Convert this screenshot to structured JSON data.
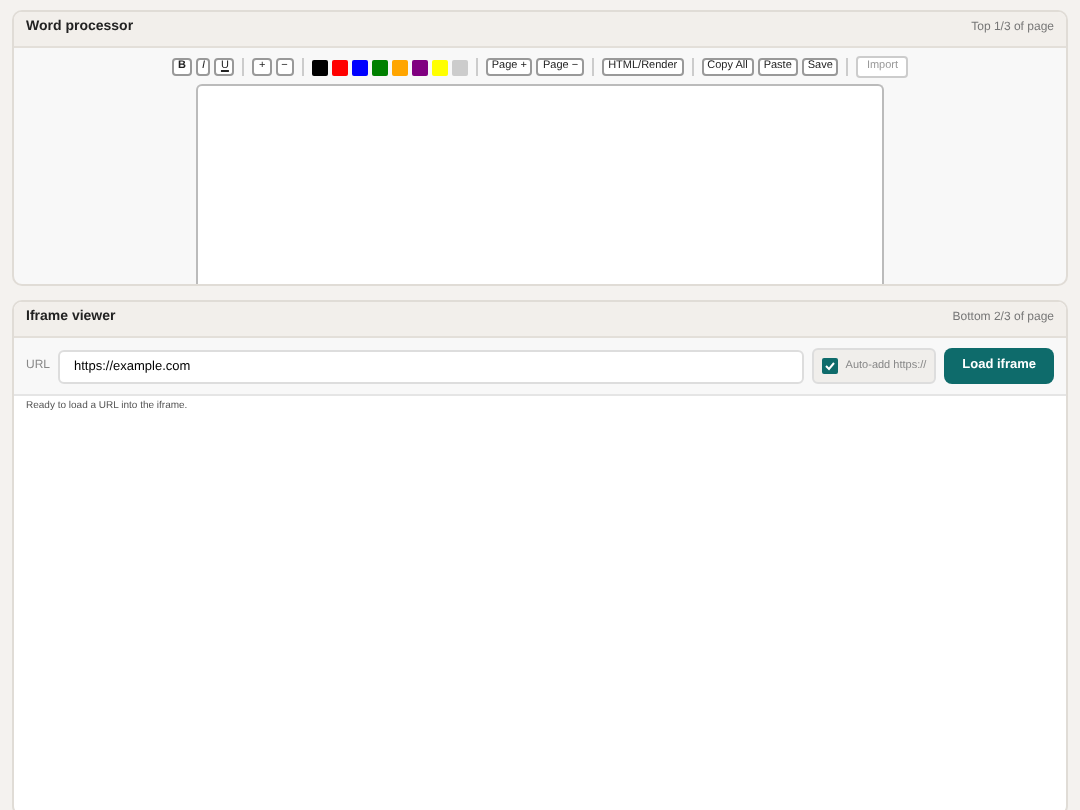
{
  "word_processor": {
    "title": "Word processor",
    "note": "Top 1/3 of page",
    "toolbar": [
      [
        {
          "kind": "bold",
          "label": "B",
          "disabled": false
        },
        {
          "kind": "italic",
          "label": "I",
          "disabled": false
        },
        {
          "kind": "underline",
          "label": "U",
          "disabled": false
        }
      ],
      [
        {
          "kind": "button",
          "label": "+",
          "disabled": false
        },
        {
          "kind": "button",
          "label": "−",
          "disabled": false
        }
      ],
      [
        {
          "kind": "swatch",
          "color": "#000000"
        },
        {
          "kind": "swatch",
          "color": "#ff0000"
        },
        {
          "kind": "swatch",
          "color": "#0000ff"
        },
        {
          "kind": "swatch",
          "color": "#008000"
        },
        {
          "kind": "swatch",
          "color": "#ffa500"
        },
        {
          "kind": "swatch",
          "color": "#800080"
        },
        {
          "kind": "swatch",
          "color": "#ffff00"
        },
        {
          "kind": "swatch",
          "color": "#cccccc"
        }
      ],
      [
        {
          "kind": "button",
          "label": "Page +",
          "disabled": false
        },
        {
          "kind": "button",
          "label": "Page −",
          "disabled": false
        }
      ],
      [
        {
          "kind": "button",
          "label": "HTML/Render",
          "disabled": false
        }
      ],
      [
        {
          "kind": "button",
          "label": "Copy All",
          "disabled": false
        },
        {
          "kind": "button",
          "label": "Paste",
          "disabled": false
        },
        {
          "kind": "button",
          "label": "Save",
          "disabled": false
        }
      ],
      [
        {
          "kind": "button",
          "label": "Import",
          "disabled": true
        }
      ]
    ]
  },
  "iframe_viewer": {
    "title": "Iframe viewer",
    "note": "Bottom 2/3 of page",
    "url_label": "URL",
    "url": "https://example.com",
    "auto_https": {
      "label": "Auto-add https://",
      "checked": true
    },
    "load_button": "Load iframe",
    "status": "Ready to load a URL into the iframe."
  }
}
